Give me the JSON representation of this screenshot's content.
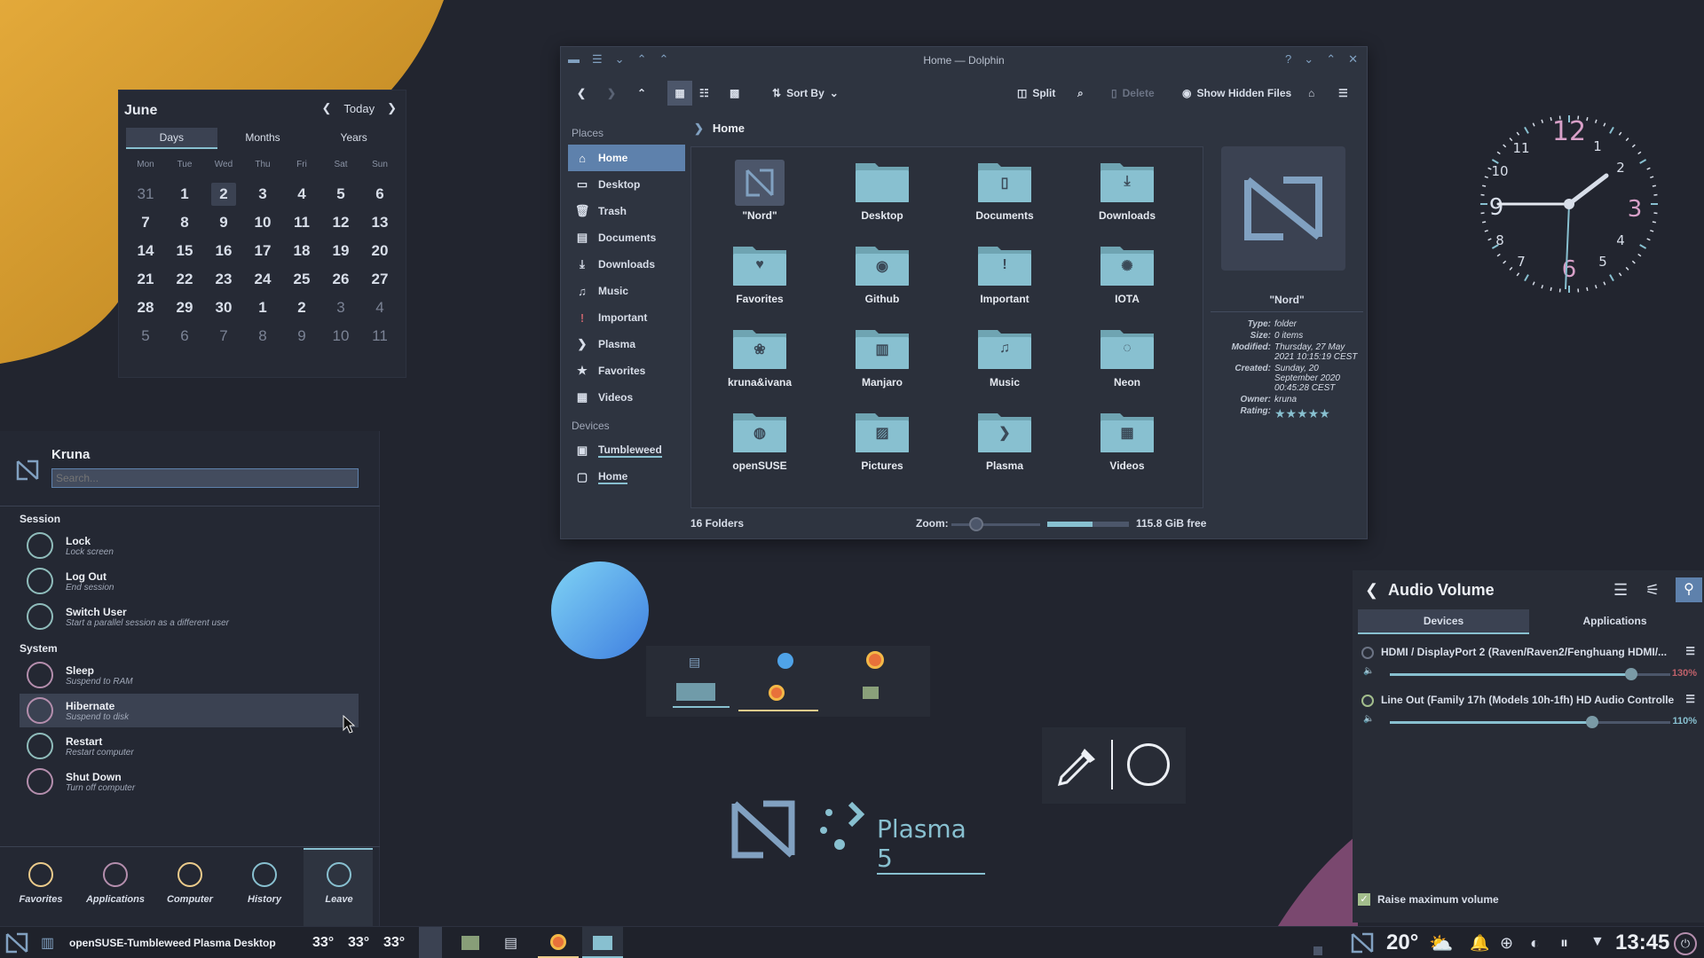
{
  "calendar": {
    "month": "June",
    "today_label": "Today",
    "tabs": [
      "Days",
      "Months",
      "Years"
    ],
    "weekdays": [
      "Mon",
      "Tue",
      "Wed",
      "Thu",
      "Fri",
      "Sat",
      "Sun"
    ],
    "days": [
      "31",
      "1",
      "2",
      "3",
      "4",
      "5",
      "6",
      "7",
      "8",
      "9",
      "10",
      "11",
      "12",
      "13",
      "14",
      "15",
      "16",
      "17",
      "18",
      "19",
      "20",
      "21",
      "22",
      "23",
      "24",
      "25",
      "26",
      "27",
      "28",
      "29",
      "30",
      "1",
      "2",
      "3",
      "4",
      "5",
      "6",
      "7",
      "8",
      "9",
      "10",
      "11"
    ],
    "today": "2"
  },
  "dolphin": {
    "title": "Home — Dolphin",
    "toolbar": {
      "sort_by": "Sort By",
      "split": "Split",
      "delete": "Delete",
      "show_hidden": "Show Hidden Files"
    },
    "places_header": "Places",
    "places": [
      {
        "label": "Home",
        "icon": "home-icon",
        "glyph": "⌂"
      },
      {
        "label": "Desktop",
        "icon": "desktop-icon",
        "glyph": "▭"
      },
      {
        "label": "Trash",
        "icon": "trash-icon",
        "glyph": "🗑"
      },
      {
        "label": "Documents",
        "icon": "documents-icon",
        "glyph": "▤"
      },
      {
        "label": "Downloads",
        "icon": "downloads-icon",
        "glyph": "⤓"
      },
      {
        "label": "Music",
        "icon": "music-icon",
        "glyph": "♫"
      },
      {
        "label": "Important",
        "icon": "important-icon",
        "glyph": "!"
      },
      {
        "label": "Plasma",
        "icon": "plasma-icon",
        "glyph": "❯"
      },
      {
        "label": "Favorites",
        "icon": "favorites-icon",
        "glyph": "★"
      },
      {
        "label": "Videos",
        "icon": "videos-icon",
        "glyph": "▦"
      }
    ],
    "devices_header": "Devices",
    "devices": [
      {
        "label": "Tumbleweed",
        "icon": "drive-icon",
        "glyph": "▣"
      },
      {
        "label": "Home",
        "icon": "drive-icon",
        "glyph": "▢"
      }
    ],
    "breadcrumb": "Home",
    "files": [
      {
        "name": "\"Nord\"",
        "icon": "nord-folder-icon",
        "glyph": "N"
      },
      {
        "name": "Desktop",
        "icon": "desktop-folder-icon",
        "glyph": ""
      },
      {
        "name": "Documents",
        "icon": "documents-folder-icon",
        "glyph": "▯"
      },
      {
        "name": "Downloads",
        "icon": "downloads-folder-icon",
        "glyph": "⤓"
      },
      {
        "name": "Favorites",
        "icon": "favorites-folder-icon",
        "glyph": "♥"
      },
      {
        "name": "Github",
        "icon": "github-folder-icon",
        "glyph": "◉"
      },
      {
        "name": "Important",
        "icon": "important-folder-icon",
        "glyph": "!"
      },
      {
        "name": "IOTA",
        "icon": "iota-folder-icon",
        "glyph": "✺"
      },
      {
        "name": "kruna&ivana",
        "icon": "kruna-ivana-folder-icon",
        "glyph": "❀"
      },
      {
        "name": "Manjaro",
        "icon": "manjaro-folder-icon",
        "glyph": "▥"
      },
      {
        "name": "Music",
        "icon": "music-folder-icon",
        "glyph": "♫"
      },
      {
        "name": "Neon",
        "icon": "neon-folder-icon",
        "glyph": "◌"
      },
      {
        "name": "openSUSE",
        "icon": "opensuse-folder-icon",
        "glyph": "◍"
      },
      {
        "name": "Pictures",
        "icon": "pictures-folder-icon",
        "glyph": "▨"
      },
      {
        "name": "Plasma",
        "icon": "plasma-folder-icon",
        "glyph": "❯"
      },
      {
        "name": "Videos",
        "icon": "videos-folder-icon",
        "glyph": "▦"
      }
    ],
    "info": {
      "name": "\"Nord\"",
      "rows": [
        {
          "k": "Type:",
          "v": "folder"
        },
        {
          "k": "Size:",
          "v": "0 items"
        },
        {
          "k": "Modified:",
          "v": "Thursday, 27 May 2021 10:15:19 CEST"
        },
        {
          "k": "Created:",
          "v": "Sunday, 20 September 2020 00:45:28 CEST"
        },
        {
          "k": "Owner:",
          "v": "kruna"
        },
        {
          "k": "Rating:",
          "v": "★★★★★"
        }
      ]
    },
    "status": {
      "count": "16 Folders",
      "zoom_label": "Zoom:",
      "free": "115.8 GiB free",
      "free_fraction": 0.55
    }
  },
  "launcher": {
    "user": "Kruna",
    "search_placeholder": "Search...",
    "session_header": "Session",
    "session": [
      {
        "title": "Lock",
        "sub": "Lock screen",
        "icon": "lock-icon"
      },
      {
        "title": "Log Out",
        "sub": "End session",
        "icon": "logout-icon"
      },
      {
        "title": "Switch User",
        "sub": "Start a parallel session as a different user",
        "icon": "switch-user-icon"
      }
    ],
    "system_header": "System",
    "system": [
      {
        "title": "Sleep",
        "sub": "Suspend to RAM",
        "icon": "sleep-icon"
      },
      {
        "title": "Hibernate",
        "sub": "Suspend to disk",
        "icon": "hibernate-icon"
      },
      {
        "title": "Restart",
        "sub": "Restart computer",
        "icon": "restart-icon"
      },
      {
        "title": "Shut Down",
        "sub": "Turn off computer",
        "icon": "shutdown-icon"
      }
    ],
    "footer": [
      {
        "label": "Favorites",
        "icon": "favorites-star-icon",
        "color": "#ebcb8b"
      },
      {
        "label": "Applications",
        "icon": "applications-icon",
        "color": "#b48ead"
      },
      {
        "label": "Computer",
        "icon": "computer-icon",
        "color": "#ebcb8b"
      },
      {
        "label": "History",
        "icon": "history-icon",
        "color": "#88c0d0"
      },
      {
        "label": "Leave",
        "icon": "leave-icon",
        "color": "#88c0d0"
      }
    ]
  },
  "audio": {
    "title": "Audio Volume",
    "tabs": [
      "Devices",
      "Applications"
    ],
    "devices": [
      {
        "name": "HDMI / DisplayPort 2 (Raven/Raven2/Fenghuang HDMI/...",
        "percent": "130%",
        "level": 0.86,
        "pct_color": "#bf616a"
      },
      {
        "name": "Line Out (Family 17h (Models 10h-1fh) HD Audio Controlle...",
        "percent": "110%",
        "level": 0.72,
        "pct_color": "#88c0d0"
      }
    ],
    "raise_max": "Raise maximum volume"
  },
  "widgets": {
    "plasma_text": "Plasma 5"
  },
  "taskbar": {
    "distro": "openSUSE-Tumbleweed",
    "desktop": "Plasma Desktop",
    "temps": [
      "33°",
      "33°",
      "33°"
    ],
    "weather_temp": "20°",
    "time": "13:45"
  },
  "colors": {
    "accent": "#88c0d0",
    "selection": "#5e81ac",
    "background": "#22252f"
  }
}
